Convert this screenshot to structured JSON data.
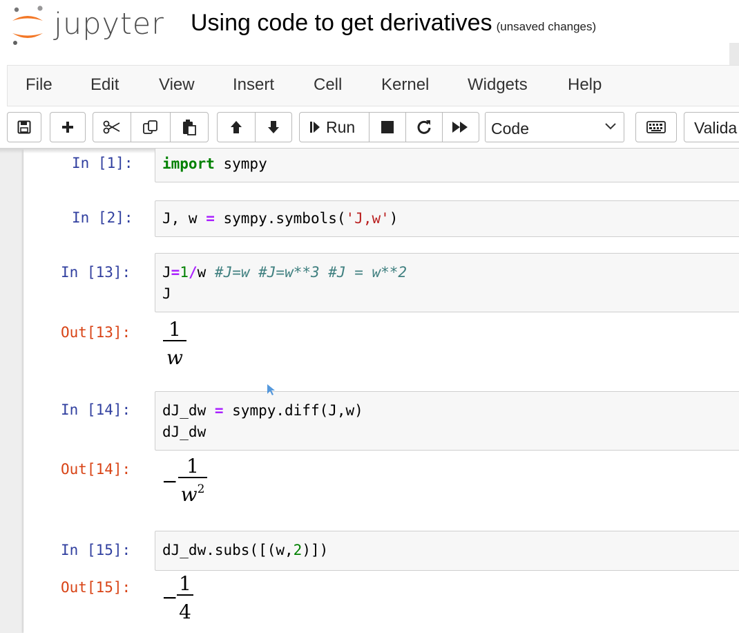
{
  "header": {
    "brand": "jupyter",
    "notebook_title": "Using code to get derivatives",
    "save_status": "(unsaved changes)"
  },
  "menubar": {
    "items": [
      "File",
      "Edit",
      "View",
      "Insert",
      "Cell",
      "Kernel",
      "Widgets",
      "Help"
    ]
  },
  "toolbar": {
    "save_icon": "floppy-disk-icon",
    "insert_icon": "plus-icon",
    "cut_icon": "scissors-icon",
    "copy_icon": "copy-icon",
    "paste_icon": "paste-icon",
    "move_up_icon": "arrow-up-icon",
    "move_down_icon": "arrow-down-icon",
    "run_label": "Run",
    "stop_icon": "stop-icon",
    "restart_icon": "restart-icon",
    "fast_forward_icon": "fast-forward-icon",
    "cell_type_value": "Code",
    "keyboard_icon": "keyboard-icon",
    "validate_label": "Valida"
  },
  "cells": [
    {
      "in_prompt": "In [1]:",
      "lines": [
        [
          [
            "kw",
            "import"
          ],
          [
            "",
            " sympy"
          ]
        ]
      ]
    },
    {
      "in_prompt": "In [2]:",
      "lines": [
        [
          [
            "",
            "J, w "
          ],
          [
            "op",
            "="
          ],
          [
            "",
            " sympy.symbols("
          ],
          [
            "str",
            "'J,w'"
          ],
          [
            "",
            ")"
          ]
        ]
      ]
    },
    {
      "in_prompt": "In [13]:",
      "lines": [
        [
          [
            "",
            "J"
          ],
          [
            "op",
            "="
          ],
          [
            "num",
            "1"
          ],
          [
            "op",
            "/"
          ],
          [
            "",
            "w "
          ],
          [
            "cm",
            "#J=w #J=w**3 #J = w**2"
          ]
        ],
        [
          [
            "",
            "J"
          ]
        ]
      ],
      "out_prompt": "Out[13]:",
      "output": {
        "sign": "",
        "numerator": "1",
        "denominator": "w",
        "exponent": ""
      }
    },
    {
      "in_prompt": "In [14]:",
      "lines": [
        [
          [
            "",
            "dJ_dw "
          ],
          [
            "op",
            "="
          ],
          [
            "",
            " sympy.diff(J,w)"
          ]
        ],
        [
          [
            "",
            "dJ_dw"
          ]
        ]
      ],
      "out_prompt": "Out[14]:",
      "output": {
        "sign": "−",
        "numerator": "1",
        "denominator": "w",
        "exponent": "2"
      }
    },
    {
      "in_prompt": "In [15]:",
      "lines": [
        [
          [
            "",
            "dJ_dw.subs([(w,"
          ],
          [
            "num",
            "2"
          ],
          [
            "",
            ")])"
          ]
        ]
      ],
      "out_prompt": "Out[15]:",
      "output": {
        "sign": "−",
        "numerator": "1",
        "denominator": "4",
        "exponent": ""
      }
    }
  ]
}
